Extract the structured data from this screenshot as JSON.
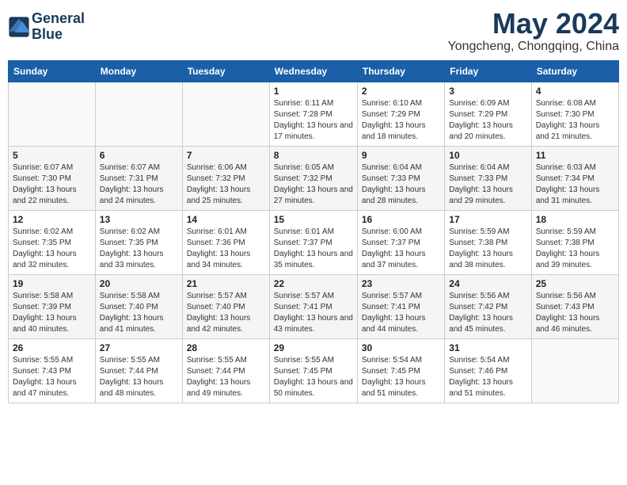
{
  "logo": {
    "name": "General",
    "name2": "Blue"
  },
  "title": "May 2024",
  "subtitle": "Yongcheng, Chongqing, China",
  "days_of_week": [
    "Sunday",
    "Monday",
    "Tuesday",
    "Wednesday",
    "Thursday",
    "Friday",
    "Saturday"
  ],
  "weeks": [
    [
      {
        "day": "",
        "info": ""
      },
      {
        "day": "",
        "info": ""
      },
      {
        "day": "",
        "info": ""
      },
      {
        "day": "1",
        "sunrise": "Sunrise: 6:11 AM",
        "sunset": "Sunset: 7:28 PM",
        "daylight": "Daylight: 13 hours and 17 minutes."
      },
      {
        "day": "2",
        "sunrise": "Sunrise: 6:10 AM",
        "sunset": "Sunset: 7:29 PM",
        "daylight": "Daylight: 13 hours and 18 minutes."
      },
      {
        "day": "3",
        "sunrise": "Sunrise: 6:09 AM",
        "sunset": "Sunset: 7:29 PM",
        "daylight": "Daylight: 13 hours and 20 minutes."
      },
      {
        "day": "4",
        "sunrise": "Sunrise: 6:08 AM",
        "sunset": "Sunset: 7:30 PM",
        "daylight": "Daylight: 13 hours and 21 minutes."
      }
    ],
    [
      {
        "day": "5",
        "sunrise": "Sunrise: 6:07 AM",
        "sunset": "Sunset: 7:30 PM",
        "daylight": "Daylight: 13 hours and 22 minutes."
      },
      {
        "day": "6",
        "sunrise": "Sunrise: 6:07 AM",
        "sunset": "Sunset: 7:31 PM",
        "daylight": "Daylight: 13 hours and 24 minutes."
      },
      {
        "day": "7",
        "sunrise": "Sunrise: 6:06 AM",
        "sunset": "Sunset: 7:32 PM",
        "daylight": "Daylight: 13 hours and 25 minutes."
      },
      {
        "day": "8",
        "sunrise": "Sunrise: 6:05 AM",
        "sunset": "Sunset: 7:32 PM",
        "daylight": "Daylight: 13 hours and 27 minutes."
      },
      {
        "day": "9",
        "sunrise": "Sunrise: 6:04 AM",
        "sunset": "Sunset: 7:33 PM",
        "daylight": "Daylight: 13 hours and 28 minutes."
      },
      {
        "day": "10",
        "sunrise": "Sunrise: 6:04 AM",
        "sunset": "Sunset: 7:33 PM",
        "daylight": "Daylight: 13 hours and 29 minutes."
      },
      {
        "day": "11",
        "sunrise": "Sunrise: 6:03 AM",
        "sunset": "Sunset: 7:34 PM",
        "daylight": "Daylight: 13 hours and 31 minutes."
      }
    ],
    [
      {
        "day": "12",
        "sunrise": "Sunrise: 6:02 AM",
        "sunset": "Sunset: 7:35 PM",
        "daylight": "Daylight: 13 hours and 32 minutes."
      },
      {
        "day": "13",
        "sunrise": "Sunrise: 6:02 AM",
        "sunset": "Sunset: 7:35 PM",
        "daylight": "Daylight: 13 hours and 33 minutes."
      },
      {
        "day": "14",
        "sunrise": "Sunrise: 6:01 AM",
        "sunset": "Sunset: 7:36 PM",
        "daylight": "Daylight: 13 hours and 34 minutes."
      },
      {
        "day": "15",
        "sunrise": "Sunrise: 6:01 AM",
        "sunset": "Sunset: 7:37 PM",
        "daylight": "Daylight: 13 hours and 35 minutes."
      },
      {
        "day": "16",
        "sunrise": "Sunrise: 6:00 AM",
        "sunset": "Sunset: 7:37 PM",
        "daylight": "Daylight: 13 hours and 37 minutes."
      },
      {
        "day": "17",
        "sunrise": "Sunrise: 5:59 AM",
        "sunset": "Sunset: 7:38 PM",
        "daylight": "Daylight: 13 hours and 38 minutes."
      },
      {
        "day": "18",
        "sunrise": "Sunrise: 5:59 AM",
        "sunset": "Sunset: 7:38 PM",
        "daylight": "Daylight: 13 hours and 39 minutes."
      }
    ],
    [
      {
        "day": "19",
        "sunrise": "Sunrise: 5:58 AM",
        "sunset": "Sunset: 7:39 PM",
        "daylight": "Daylight: 13 hours and 40 minutes."
      },
      {
        "day": "20",
        "sunrise": "Sunrise: 5:58 AM",
        "sunset": "Sunset: 7:40 PM",
        "daylight": "Daylight: 13 hours and 41 minutes."
      },
      {
        "day": "21",
        "sunrise": "Sunrise: 5:57 AM",
        "sunset": "Sunset: 7:40 PM",
        "daylight": "Daylight: 13 hours and 42 minutes."
      },
      {
        "day": "22",
        "sunrise": "Sunrise: 5:57 AM",
        "sunset": "Sunset: 7:41 PM",
        "daylight": "Daylight: 13 hours and 43 minutes."
      },
      {
        "day": "23",
        "sunrise": "Sunrise: 5:57 AM",
        "sunset": "Sunset: 7:41 PM",
        "daylight": "Daylight: 13 hours and 44 minutes."
      },
      {
        "day": "24",
        "sunrise": "Sunrise: 5:56 AM",
        "sunset": "Sunset: 7:42 PM",
        "daylight": "Daylight: 13 hours and 45 minutes."
      },
      {
        "day": "25",
        "sunrise": "Sunrise: 5:56 AM",
        "sunset": "Sunset: 7:43 PM",
        "daylight": "Daylight: 13 hours and 46 minutes."
      }
    ],
    [
      {
        "day": "26",
        "sunrise": "Sunrise: 5:55 AM",
        "sunset": "Sunset: 7:43 PM",
        "daylight": "Daylight: 13 hours and 47 minutes."
      },
      {
        "day": "27",
        "sunrise": "Sunrise: 5:55 AM",
        "sunset": "Sunset: 7:44 PM",
        "daylight": "Daylight: 13 hours and 48 minutes."
      },
      {
        "day": "28",
        "sunrise": "Sunrise: 5:55 AM",
        "sunset": "Sunset: 7:44 PM",
        "daylight": "Daylight: 13 hours and 49 minutes."
      },
      {
        "day": "29",
        "sunrise": "Sunrise: 5:55 AM",
        "sunset": "Sunset: 7:45 PM",
        "daylight": "Daylight: 13 hours and 50 minutes."
      },
      {
        "day": "30",
        "sunrise": "Sunrise: 5:54 AM",
        "sunset": "Sunset: 7:45 PM",
        "daylight": "Daylight: 13 hours and 51 minutes."
      },
      {
        "day": "31",
        "sunrise": "Sunrise: 5:54 AM",
        "sunset": "Sunset: 7:46 PM",
        "daylight": "Daylight: 13 hours and 51 minutes."
      },
      {
        "day": "",
        "info": ""
      }
    ]
  ]
}
